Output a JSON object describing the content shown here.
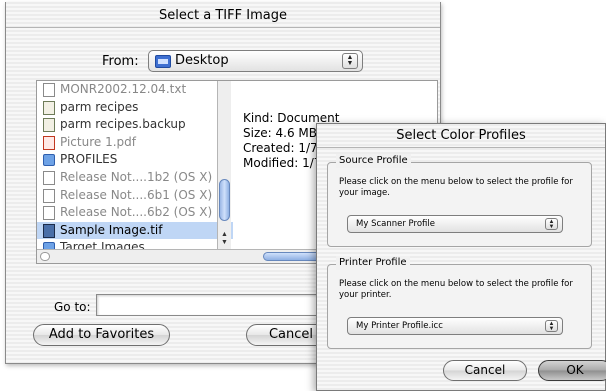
{
  "tiff_dialog": {
    "title": "Select a TIFF Image",
    "from_label": "From:",
    "from_value": "Desktop",
    "files": [
      {
        "name": "MONR2002.12.04.txt",
        "icon": "text-doc-icon",
        "style": "dim"
      },
      {
        "name": "parm recipes",
        "icon": "recipe-doc-icon",
        "style": "normal"
      },
      {
        "name": "parm recipes.backup",
        "icon": "recipe-doc-icon",
        "style": "normal"
      },
      {
        "name": "Picture 1.pdf",
        "icon": "pdf-icon",
        "style": "dim"
      },
      {
        "name": "PROFILES",
        "icon": "folder-icon",
        "style": "folder"
      },
      {
        "name": "Release Not....1b2 (OS X)",
        "icon": "doc-icon",
        "style": "dim"
      },
      {
        "name": "Release Not....6b1 (OS X)",
        "icon": "doc-icon",
        "style": "dim"
      },
      {
        "name": "Release Not....6b2 (OS X)",
        "icon": "doc-icon",
        "style": "dim"
      },
      {
        "name": "Sample Image.tif",
        "icon": "image-icon",
        "style": "selected"
      },
      {
        "name": "Target Images",
        "icon": "folder-icon",
        "style": "folder"
      }
    ],
    "preview": {
      "kind": "Kind: Document",
      "size": "Size: 4.6 MB",
      "created": "Created: 1/7",
      "modified": "Modified: 1/7"
    },
    "goto_label": "Go to:",
    "goto_value": "",
    "add_favorites_label": "Add to Favorites",
    "cancel_label": "Cancel"
  },
  "profiles_dialog": {
    "title": "Select Color Profiles",
    "source": {
      "title": "Source Profile",
      "text": "Please click on the menu  below to select the profile for your image.",
      "selected": "My Scanner Profile"
    },
    "printer": {
      "title": "Printer Profile",
      "text": "Please click on the menu  below to select the profile for your printer.",
      "selected": "My Printer Profile.icc"
    },
    "cancel_label": "Cancel",
    "ok_label": "OK"
  },
  "colors": {
    "selection": "#bfd6f5",
    "aqua_blue": "#8fb0e3"
  }
}
